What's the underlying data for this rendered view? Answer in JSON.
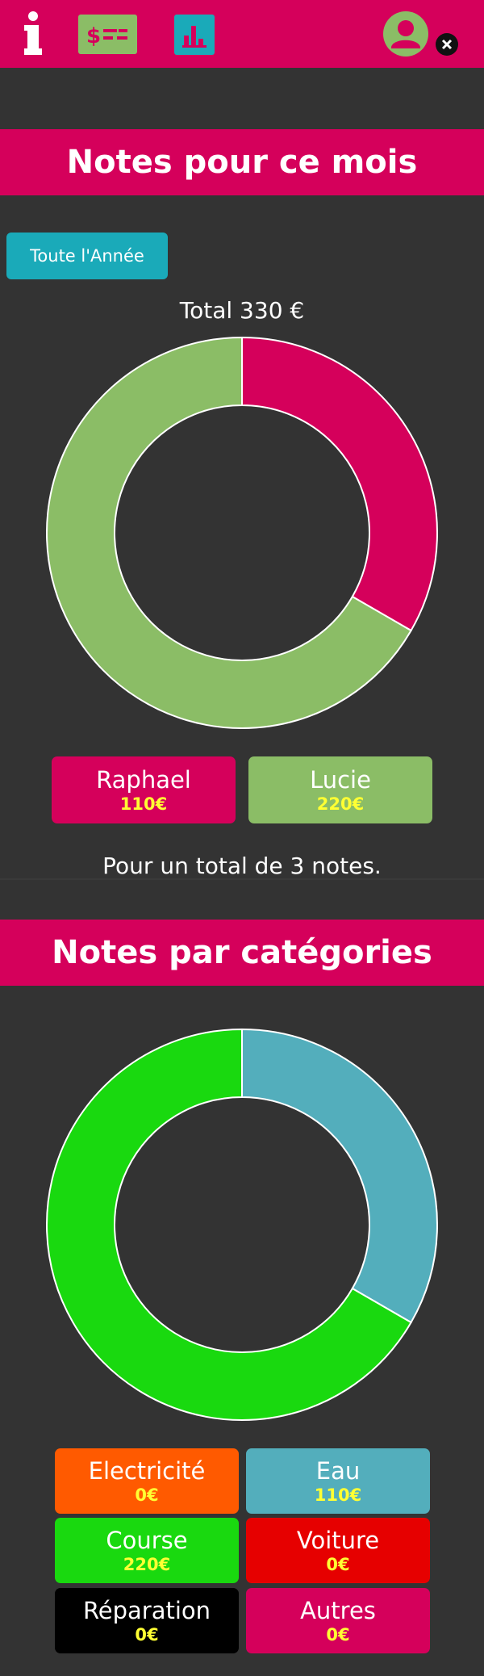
{
  "topbar": {
    "icons": [
      "info-icon",
      "money-icon",
      "bar-chart-icon",
      "user-avatar-icon",
      "close-icon"
    ],
    "colors": {
      "bar": "#d5005b",
      "money": "#8bbd66",
      "chart": "#1aaab9"
    }
  },
  "monthly": {
    "title": "Notes pour ce mois",
    "year_button": "Toute l'Année",
    "total_label": "Total 330 €",
    "people": [
      {
        "name": "Raphael",
        "amount": "110€",
        "color": "#d5005b"
      },
      {
        "name": "Lucie",
        "amount": "220€",
        "color": "#8bbd66"
      }
    ],
    "count_text": "Pour un total de 3 notes."
  },
  "categories": {
    "title": "Notes par catégories",
    "items": [
      {
        "name": "Electricité",
        "amount": "0€",
        "color": "#ff5a00"
      },
      {
        "name": "Eau",
        "amount": "110€",
        "color": "#53aebc"
      },
      {
        "name": "Course",
        "amount": "220€",
        "color": "#19d90f"
      },
      {
        "name": "Voiture",
        "amount": "0€",
        "color": "#e60000"
      },
      {
        "name": "Réparation",
        "amount": "0€",
        "color": "#000000"
      },
      {
        "name": "Autres",
        "amount": "0€",
        "color": "#d5005b"
      }
    ]
  },
  "chart_data": [
    {
      "type": "pie",
      "categories": [
        "Raphael",
        "Lucie"
      ],
      "values": [
        110,
        220
      ],
      "colors": [
        "#d5005b",
        "#8bbd66"
      ]
    },
    {
      "type": "pie",
      "categories": [
        "Electricité",
        "Eau",
        "Course",
        "Voiture",
        "Réparation",
        "Autres"
      ],
      "values": [
        0,
        110,
        220,
        0,
        0,
        0
      ],
      "colors": [
        "#ff5a00",
        "#53aebc",
        "#19d90f",
        "#e60000",
        "#000000",
        "#d5005b"
      ]
    }
  ]
}
